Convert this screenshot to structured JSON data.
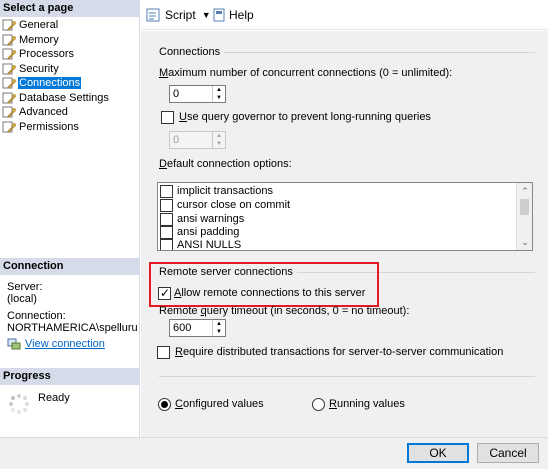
{
  "left": {
    "page_header": "Select a page",
    "pages": [
      {
        "label": "General"
      },
      {
        "label": "Memory"
      },
      {
        "label": "Processors"
      },
      {
        "label": "Security"
      },
      {
        "label": "Connections"
      },
      {
        "label": "Database Settings"
      },
      {
        "label": "Advanced"
      },
      {
        "label": "Permissions"
      }
    ],
    "connection_header": "Connection",
    "server_label": "Server:",
    "server_value": "(local)",
    "connection_label": "Connection:",
    "connection_value": "NORTHAMERICA\\spelluru",
    "view_connection": "View connection",
    "progress_header": "Progress",
    "progress_status": "Ready"
  },
  "toolbar": {
    "script_label": "Script",
    "help_label": "Help"
  },
  "connections": {
    "group_title": "Connections",
    "max_label_prefix": "M",
    "max_label_rest": "aximum number of concurrent connections (0 = unlimited):",
    "max_value": "0",
    "governor_label_prefix": "U",
    "governor_label_rest": "se query governor to prevent long-running queries",
    "governor_value": "0",
    "default_options_prefix": "D",
    "default_options_rest": "efault connection options:",
    "options": [
      {
        "label": "implicit transactions"
      },
      {
        "label": "cursor close on commit"
      },
      {
        "label": "ansi warnings"
      },
      {
        "label": "ansi padding"
      },
      {
        "label": "ANSI NULLS"
      }
    ]
  },
  "remote": {
    "group_title": "Remote server connections",
    "allow_prefix": "A",
    "allow_rest": "llow remote connections to this server",
    "allow_checked": true,
    "timeout_label_a": "Remote ",
    "timeout_label_u": "q",
    "timeout_label_b": "uery timeout (in seconds, 0 = no timeout):",
    "timeout_value": "600",
    "distributed_prefix": "R",
    "distributed_rest": "equire distributed transactions for server-to-server communication"
  },
  "values": {
    "configured_prefix": "C",
    "configured_rest": "onfigured values",
    "running_prefix": "R",
    "running_rest": "unning values",
    "selected": "configured"
  },
  "buttons": {
    "ok": "OK",
    "cancel": "Cancel"
  },
  "colors": {
    "selection": "#0078d7",
    "highlight_box": "#e21a24",
    "header_bg": "#d6dbe9"
  }
}
